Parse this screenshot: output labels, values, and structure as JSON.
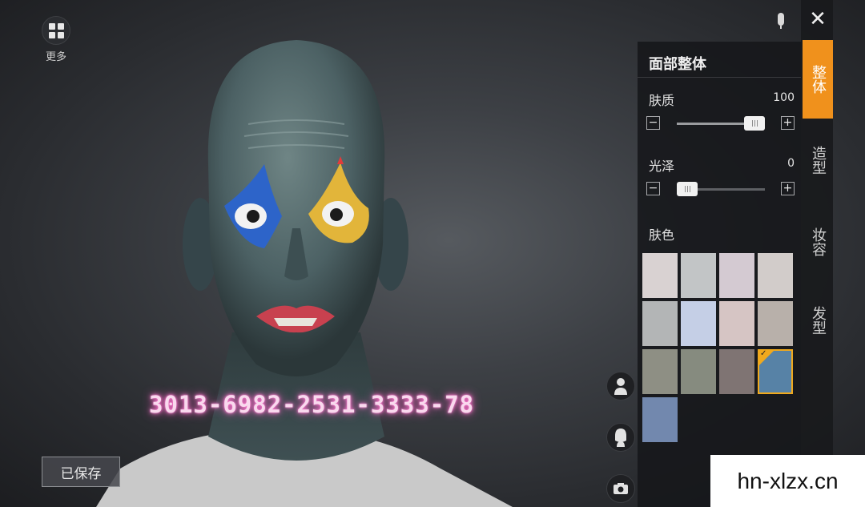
{
  "more": {
    "label": "更多",
    "icon": "grid-icon"
  },
  "watermark": {
    "text": "3013-6982-2531-3333-78"
  },
  "saved_button": {
    "label": "已保存"
  },
  "panel": {
    "title": "面部整体",
    "skin_texture": {
      "label": "肤质",
      "value": "100",
      "fraction": 1.0
    },
    "gloss": {
      "label": "光泽",
      "value": "0",
      "fraction": 0.0
    },
    "skin_color": {
      "label": "肤色",
      "swatches": [
        "#d9d2d2",
        "#c2c5c6",
        "#d4cad2",
        "#d2ccca",
        "#b3b5b6",
        "#c5cfe6",
        "#d6c5c4",
        "#b8b0aa",
        "#8e8f84",
        "#868b7f",
        "#7f7473",
        "#5782a6",
        "#7288ae"
      ],
      "selected_index": 11
    }
  },
  "tabs": [
    {
      "label": "整体",
      "active": true
    },
    {
      "label": "造型",
      "active": false
    },
    {
      "label": "妆容",
      "active": false
    },
    {
      "label": "发型",
      "active": false
    }
  ],
  "close_label": "✕",
  "site_label": "hn-xlzx.cn",
  "colors": {
    "accent": "#f0911c",
    "panel_bg": "#16171a"
  }
}
